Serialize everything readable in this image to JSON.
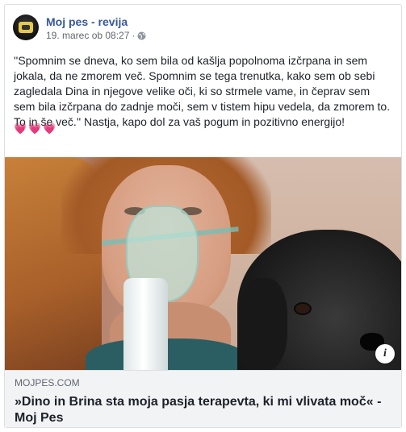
{
  "post": {
    "page_name": "Moj pes - revija",
    "date": "19. marec ob 08:27",
    "separator": "·",
    "text": "''Spomnim se dneva, ko sem bila od kašlja popolnoma izčrpana in sem jokala, da ne zmorem več. Spomnim se tega trenutka, kako sem ob sebi zagledala Dina in njegove velike oči, ki so strmele vame, in čeprav sem sem bila izčrpana do zadnje moči, sem v tistem hipu vedela, da zmorem to. To in še več.'' Nastja, kapo dol za vaš pogum in pozitivno energijo!",
    "hearts": [
      "💗",
      "💗",
      "💗"
    ],
    "privacy_icon": "globe-icon"
  },
  "link": {
    "domain": "MOJPES.COM",
    "title": "»Dino in Brina sta moja pasja terapevta, ki mi vlivata moč« - Moj Pes",
    "info_label": "i"
  },
  "colors": {
    "page_name": "#385898",
    "text": "#1d2129",
    "meta": "#616770",
    "link_bg": "#f2f3f5"
  }
}
